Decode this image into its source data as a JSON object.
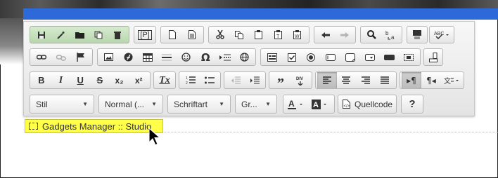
{
  "toolbar": {
    "row1": {
      "document_buttons": [
        "save",
        "wizard",
        "folder",
        "copy",
        "trash"
      ],
      "placeholder_button": "[P]",
      "cut_copy": [
        "new-page",
        "page",
        "cut",
        "copy",
        "paste",
        "paste-text",
        "paste-word"
      ],
      "history": [
        "undo",
        "redo"
      ],
      "find": [
        "find",
        "replace"
      ],
      "misc": [
        "format-block",
        "spell-check"
      ]
    },
    "row3_labels": {
      "bold": "B",
      "italic": "I",
      "underline": "U",
      "strike": "S",
      "subscript": "x₂",
      "superscript": "x²",
      "remove_format": "Tx"
    },
    "row4": {
      "style_label": "Stil",
      "format_label": "Normal (...",
      "font_label": "Schriftart",
      "size_label": "Gr...",
      "source_label": "Quellcode",
      "help_label": "?"
    }
  },
  "tag": {
    "label": "Gadgets Manager :: Studio"
  },
  "colors": {
    "highlight": "#ffff47",
    "accent_blue": "#2d69d8",
    "group_green": "#c4dfba"
  }
}
